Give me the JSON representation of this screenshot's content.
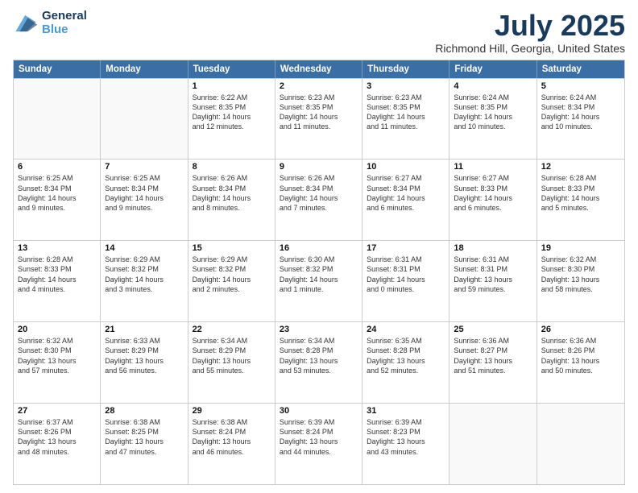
{
  "header": {
    "logo_line1": "General",
    "logo_line2": "Blue",
    "title": "July 2025",
    "subtitle": "Richmond Hill, Georgia, United States"
  },
  "days_of_week": [
    "Sunday",
    "Monday",
    "Tuesday",
    "Wednesday",
    "Thursday",
    "Friday",
    "Saturday"
  ],
  "weeks": [
    [
      {
        "day": "",
        "lines": []
      },
      {
        "day": "",
        "lines": []
      },
      {
        "day": "1",
        "lines": [
          "Sunrise: 6:22 AM",
          "Sunset: 8:35 PM",
          "Daylight: 14 hours",
          "and 12 minutes."
        ]
      },
      {
        "day": "2",
        "lines": [
          "Sunrise: 6:23 AM",
          "Sunset: 8:35 PM",
          "Daylight: 14 hours",
          "and 11 minutes."
        ]
      },
      {
        "day": "3",
        "lines": [
          "Sunrise: 6:23 AM",
          "Sunset: 8:35 PM",
          "Daylight: 14 hours",
          "and 11 minutes."
        ]
      },
      {
        "day": "4",
        "lines": [
          "Sunrise: 6:24 AM",
          "Sunset: 8:35 PM",
          "Daylight: 14 hours",
          "and 10 minutes."
        ]
      },
      {
        "day": "5",
        "lines": [
          "Sunrise: 6:24 AM",
          "Sunset: 8:34 PM",
          "Daylight: 14 hours",
          "and 10 minutes."
        ]
      }
    ],
    [
      {
        "day": "6",
        "lines": [
          "Sunrise: 6:25 AM",
          "Sunset: 8:34 PM",
          "Daylight: 14 hours",
          "and 9 minutes."
        ]
      },
      {
        "day": "7",
        "lines": [
          "Sunrise: 6:25 AM",
          "Sunset: 8:34 PM",
          "Daylight: 14 hours",
          "and 9 minutes."
        ]
      },
      {
        "day": "8",
        "lines": [
          "Sunrise: 6:26 AM",
          "Sunset: 8:34 PM",
          "Daylight: 14 hours",
          "and 8 minutes."
        ]
      },
      {
        "day": "9",
        "lines": [
          "Sunrise: 6:26 AM",
          "Sunset: 8:34 PM",
          "Daylight: 14 hours",
          "and 7 minutes."
        ]
      },
      {
        "day": "10",
        "lines": [
          "Sunrise: 6:27 AM",
          "Sunset: 8:34 PM",
          "Daylight: 14 hours",
          "and 6 minutes."
        ]
      },
      {
        "day": "11",
        "lines": [
          "Sunrise: 6:27 AM",
          "Sunset: 8:33 PM",
          "Daylight: 14 hours",
          "and 6 minutes."
        ]
      },
      {
        "day": "12",
        "lines": [
          "Sunrise: 6:28 AM",
          "Sunset: 8:33 PM",
          "Daylight: 14 hours",
          "and 5 minutes."
        ]
      }
    ],
    [
      {
        "day": "13",
        "lines": [
          "Sunrise: 6:28 AM",
          "Sunset: 8:33 PM",
          "Daylight: 14 hours",
          "and 4 minutes."
        ]
      },
      {
        "day": "14",
        "lines": [
          "Sunrise: 6:29 AM",
          "Sunset: 8:32 PM",
          "Daylight: 14 hours",
          "and 3 minutes."
        ]
      },
      {
        "day": "15",
        "lines": [
          "Sunrise: 6:29 AM",
          "Sunset: 8:32 PM",
          "Daylight: 14 hours",
          "and 2 minutes."
        ]
      },
      {
        "day": "16",
        "lines": [
          "Sunrise: 6:30 AM",
          "Sunset: 8:32 PM",
          "Daylight: 14 hours",
          "and 1 minute."
        ]
      },
      {
        "day": "17",
        "lines": [
          "Sunrise: 6:31 AM",
          "Sunset: 8:31 PM",
          "Daylight: 14 hours",
          "and 0 minutes."
        ]
      },
      {
        "day": "18",
        "lines": [
          "Sunrise: 6:31 AM",
          "Sunset: 8:31 PM",
          "Daylight: 13 hours",
          "and 59 minutes."
        ]
      },
      {
        "day": "19",
        "lines": [
          "Sunrise: 6:32 AM",
          "Sunset: 8:30 PM",
          "Daylight: 13 hours",
          "and 58 minutes."
        ]
      }
    ],
    [
      {
        "day": "20",
        "lines": [
          "Sunrise: 6:32 AM",
          "Sunset: 8:30 PM",
          "Daylight: 13 hours",
          "and 57 minutes."
        ]
      },
      {
        "day": "21",
        "lines": [
          "Sunrise: 6:33 AM",
          "Sunset: 8:29 PM",
          "Daylight: 13 hours",
          "and 56 minutes."
        ]
      },
      {
        "day": "22",
        "lines": [
          "Sunrise: 6:34 AM",
          "Sunset: 8:29 PM",
          "Daylight: 13 hours",
          "and 55 minutes."
        ]
      },
      {
        "day": "23",
        "lines": [
          "Sunrise: 6:34 AM",
          "Sunset: 8:28 PM",
          "Daylight: 13 hours",
          "and 53 minutes."
        ]
      },
      {
        "day": "24",
        "lines": [
          "Sunrise: 6:35 AM",
          "Sunset: 8:28 PM",
          "Daylight: 13 hours",
          "and 52 minutes."
        ]
      },
      {
        "day": "25",
        "lines": [
          "Sunrise: 6:36 AM",
          "Sunset: 8:27 PM",
          "Daylight: 13 hours",
          "and 51 minutes."
        ]
      },
      {
        "day": "26",
        "lines": [
          "Sunrise: 6:36 AM",
          "Sunset: 8:26 PM",
          "Daylight: 13 hours",
          "and 50 minutes."
        ]
      }
    ],
    [
      {
        "day": "27",
        "lines": [
          "Sunrise: 6:37 AM",
          "Sunset: 8:26 PM",
          "Daylight: 13 hours",
          "and 48 minutes."
        ]
      },
      {
        "day": "28",
        "lines": [
          "Sunrise: 6:38 AM",
          "Sunset: 8:25 PM",
          "Daylight: 13 hours",
          "and 47 minutes."
        ]
      },
      {
        "day": "29",
        "lines": [
          "Sunrise: 6:38 AM",
          "Sunset: 8:24 PM",
          "Daylight: 13 hours",
          "and 46 minutes."
        ]
      },
      {
        "day": "30",
        "lines": [
          "Sunrise: 6:39 AM",
          "Sunset: 8:24 PM",
          "Daylight: 13 hours",
          "and 44 minutes."
        ]
      },
      {
        "day": "31",
        "lines": [
          "Sunrise: 6:39 AM",
          "Sunset: 8:23 PM",
          "Daylight: 13 hours",
          "and 43 minutes."
        ]
      },
      {
        "day": "",
        "lines": []
      },
      {
        "day": "",
        "lines": []
      }
    ]
  ]
}
